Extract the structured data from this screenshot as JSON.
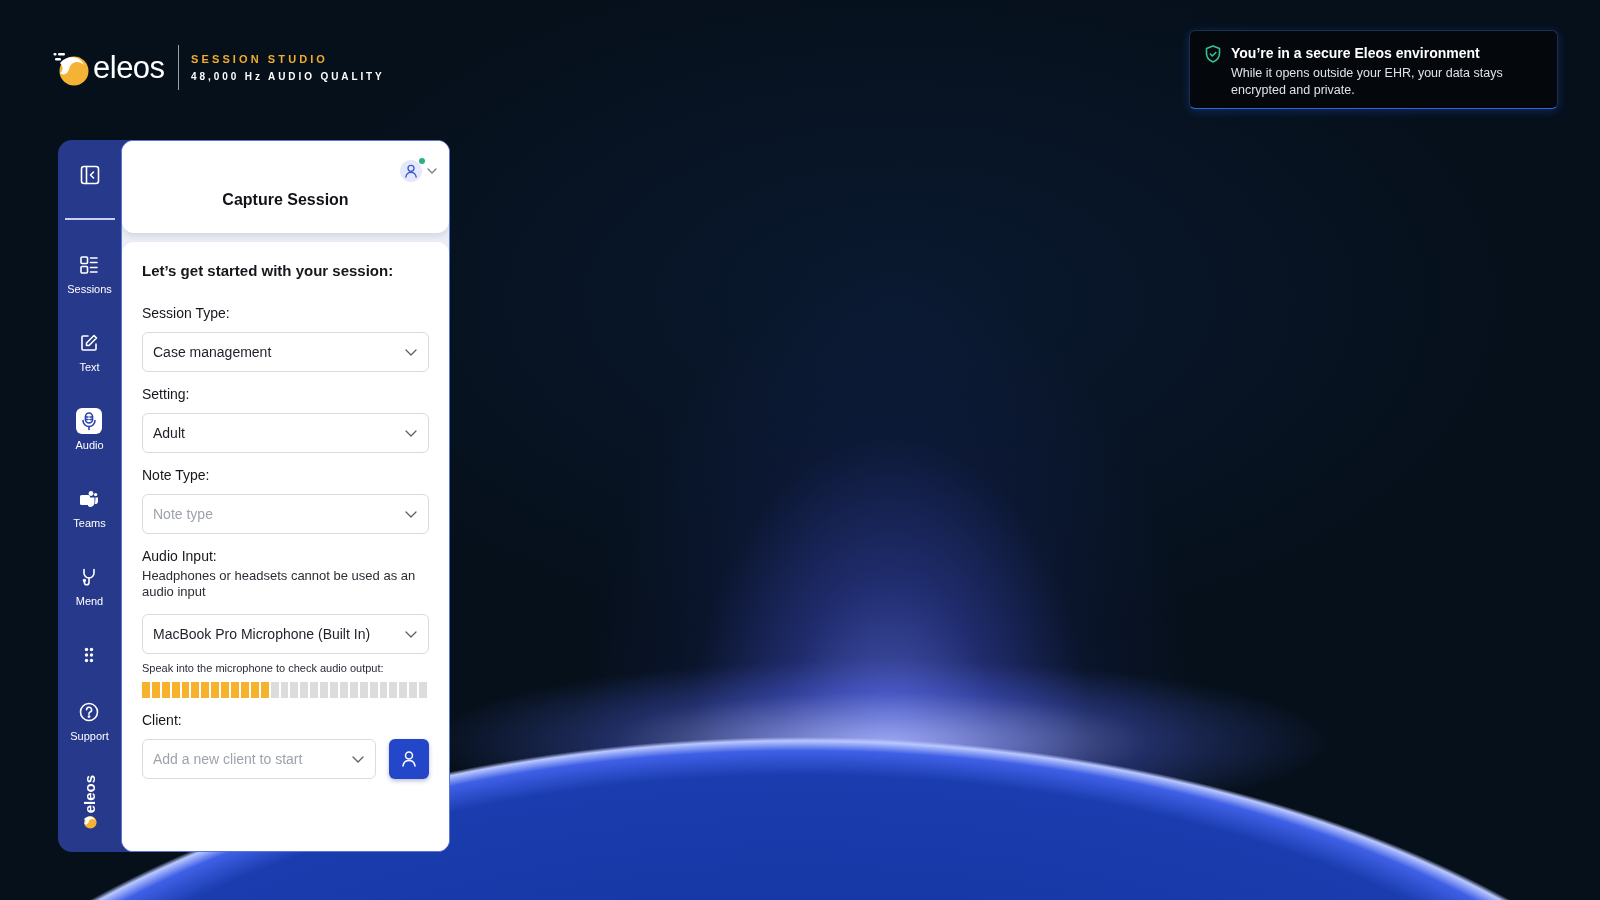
{
  "brand": {
    "name": "eleos",
    "product": "SESSION STUDIO",
    "tagline": "48,000 Hz AUDIO QUALITY"
  },
  "security_notice": {
    "title": "You’re in a secure Eleos environment",
    "text": "While it opens outside your EHR, your data stays encrypted and private."
  },
  "sidebar": {
    "items": [
      {
        "kind": "sessions",
        "label": "Sessions",
        "selected": false
      },
      {
        "kind": "text",
        "label": "Text",
        "selected": false
      },
      {
        "kind": "audio",
        "label": "Audio",
        "selected": true
      },
      {
        "kind": "teams",
        "label": "Teams",
        "selected": false
      },
      {
        "kind": "mend",
        "label": "Mend",
        "selected": false
      },
      {
        "kind": "more",
        "selected": false
      },
      {
        "kind": "support",
        "label": "Support",
        "selected": false
      }
    ],
    "logo": "eleos"
  },
  "panel": {
    "title": "Capture Session",
    "user_online": true,
    "intro": "Let’s get started with your session:",
    "fields": [
      {
        "label": "Session Type:",
        "value": "Case management"
      },
      {
        "label": "Setting:",
        "value": "Adult"
      },
      {
        "label": "Note Type:",
        "placeholder": "Note type"
      },
      {
        "label": "Audio Input:",
        "help": "Headphones or headsets cannot be used as an audio input",
        "value": "MacBook Pro Microphone (Built In)"
      }
    ],
    "audio_meter": {
      "caption": "Speak into the microphone to check audio output:",
      "level": 0.45
    },
    "client": {
      "label": "Client:",
      "placeholder": "Add a new client to start"
    }
  }
}
